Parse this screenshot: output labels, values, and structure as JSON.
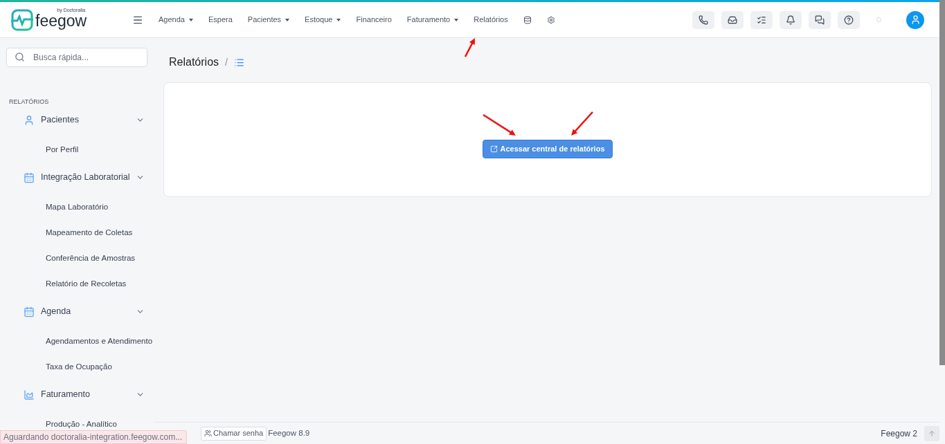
{
  "logo": {
    "name": "feegow",
    "tagline": "by Doctoralia"
  },
  "nav": [
    {
      "label": "Agenda",
      "dropdown": true
    },
    {
      "label": "Espera",
      "dropdown": false
    },
    {
      "label": "Pacientes",
      "dropdown": true
    },
    {
      "label": "Estoque",
      "dropdown": true
    },
    {
      "label": "Financeiro",
      "dropdown": false
    },
    {
      "label": "Faturamento",
      "dropdown": true
    },
    {
      "label": "Relatórios",
      "dropdown": false
    }
  ],
  "search": {
    "placeholder": "Busca rápida..."
  },
  "sidebar": {
    "section": "RELATÓRIOS",
    "groups": [
      {
        "label": "Pacientes",
        "kind": "user",
        "expanded": true,
        "children": [
          {
            "label": "Por Perfil"
          }
        ]
      },
      {
        "label": "Integração Laboratorial",
        "kind": "calendar",
        "expanded": true,
        "children": [
          {
            "label": "Mapa Laboratório"
          },
          {
            "label": "Mapeamento de Coletas"
          },
          {
            "label": "Conferência de Amostras"
          },
          {
            "label": "Relatório de Recoletas"
          }
        ]
      },
      {
        "label": "Agenda",
        "kind": "calendar",
        "expanded": true,
        "children": [
          {
            "label": "Agendamentos e Atendimento"
          },
          {
            "label": "Taxa de Ocupação"
          }
        ]
      },
      {
        "label": "Faturamento",
        "kind": "chart",
        "expanded": true,
        "children": [
          {
            "label": "Produção - Analítico"
          }
        ]
      }
    ]
  },
  "page": {
    "title": "Relatórios",
    "separator": "/",
    "button": "Acessar central de relatórios"
  },
  "footer": {
    "call_button": "Chamar senha",
    "version": "Feegow 8.9",
    "right": "Feegow 2"
  },
  "browser_status": "Aguardando doctoralia-integration.feegow.com..."
}
